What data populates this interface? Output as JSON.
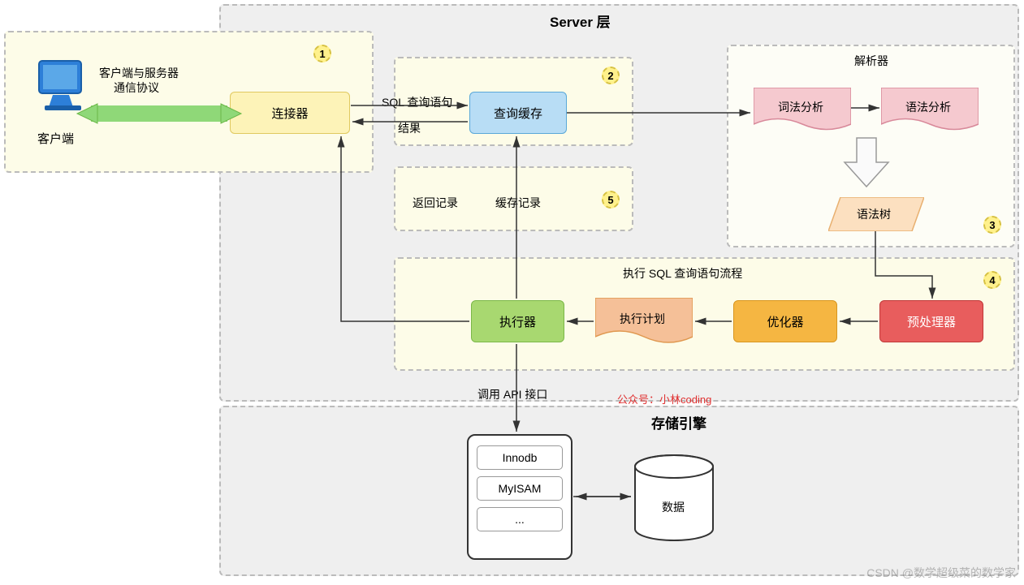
{
  "sections": {
    "server_layer": "Server 层",
    "storage_engine": "存储引擎",
    "parser": "解析器",
    "exec_flow": "执行 SQL 查询语句流程"
  },
  "badges": {
    "b1": "1",
    "b2": "2",
    "b3": "3",
    "b4": "4",
    "b5": "5"
  },
  "nodes": {
    "client": "客户端",
    "connector": "连接器",
    "query_cache": "查询缓存",
    "lexical": "词法分析",
    "syntax": "语法分析",
    "syntax_tree": "语法树",
    "preprocessor": "预处理器",
    "optimizer": "优化器",
    "exec_plan": "执行计划",
    "executor": "执行器",
    "innodb": "Innodb",
    "myisam": "MyISAM",
    "more": "...",
    "data": "数据"
  },
  "labels": {
    "client_protocol1": "客户端与服务器",
    "client_protocol2": "通信协议",
    "sql_query": "SQL 查询语句",
    "result": "结果",
    "return_record": "返回记录",
    "cache_record": "缓存记录",
    "call_api": "调用 API 接口",
    "wechat": "公众号：小林coding"
  },
  "watermark": "CSDN @数学超级菜的数学家"
}
